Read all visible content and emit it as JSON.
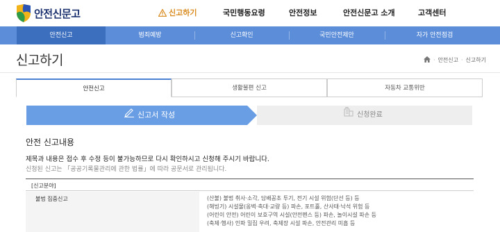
{
  "header": {
    "logo_text": "안전신문고",
    "nav": [
      {
        "label": "신고하기",
        "active": true
      },
      {
        "label": "국민행동요령",
        "active": false
      },
      {
        "label": "안전정보",
        "active": false
      },
      {
        "label": "안전신문고 소개",
        "active": false
      },
      {
        "label": "고객센터",
        "active": false
      }
    ]
  },
  "subnav": {
    "items": [
      {
        "label": "안전신고",
        "active": true
      },
      {
        "label": "범죄예방",
        "active": false
      },
      {
        "label": "신고확인",
        "active": false
      },
      {
        "label": "국민안전제안",
        "active": false
      },
      {
        "label": "자가 안전점검",
        "active": false
      }
    ]
  },
  "page": {
    "title": "신고하기",
    "breadcrumb": [
      "안전신고",
      "신고하기"
    ]
  },
  "tabs": [
    {
      "label": "안전신고",
      "active": true
    },
    {
      "label": "생활불편 신고",
      "active": false
    },
    {
      "label": "자동차 교통위반",
      "active": false
    }
  ],
  "steps": {
    "step1": "신고서 작성",
    "step2": "신청완료"
  },
  "section": {
    "title": "안전 신고내용",
    "notice1": "제목과 내용은 접수 후 수정 등이 불가능하므로 다시 확인하시고 신청해 주시기 바랍니다.",
    "notice2": "신청된 신고는 「공공기록물관리에 관한 법률」에 따라 공문서로 관리됩니다."
  },
  "table": {
    "header": "[신고분야]",
    "row_label": "불법 집중신고",
    "lines": [
      "(산불) 불법 취사·소각, 담배꽁초 투기, 전기 시설 위험(단선 등) 등",
      "(해빙기) 시설물(옹벽·축대·교량 등) 파손, 포트홀, 산사태·낙석 위험 등",
      "(어린이 안전) 어린이 보호구역 시설(안전펜스 등) 파손, 놀이시설 파손 등",
      "(축제·행사) 인파 밀집 우려, 축제장 시설 파손, 안전관리 미흡 등"
    ]
  },
  "colors": {
    "brand_navy": "#1a2f6e",
    "accent_orange": "#d98a1d",
    "subnav_blue": "#5b8dd9",
    "step_blue": "#6a9ee4"
  }
}
